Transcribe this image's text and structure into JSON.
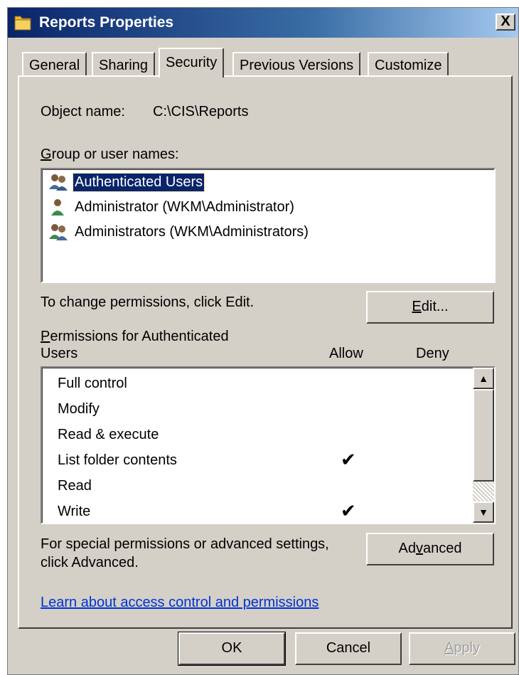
{
  "window": {
    "title": "Reports Properties",
    "close_label": "X"
  },
  "tabs": [
    {
      "label": "General",
      "active": false
    },
    {
      "label": "Sharing",
      "active": false
    },
    {
      "label": "Security",
      "active": true
    },
    {
      "label": "Previous Versions",
      "active": false
    },
    {
      "label": "Customize",
      "active": false
    }
  ],
  "security": {
    "object_name_label": "Object name:",
    "object_name_value": "C:\\CIS\\Reports",
    "group_label_u": "G",
    "group_label_rest": "roup or user names:",
    "users": [
      {
        "name": "Authenticated Users",
        "icon": "users-group-icon",
        "selected": true
      },
      {
        "name": "Administrator (WKM\\Administrator)",
        "icon": "user-icon",
        "selected": false
      },
      {
        "name": "Administrators (WKM\\Administrators)",
        "icon": "users-group-icon",
        "selected": false
      }
    ],
    "change_hint": "To change permissions, click Edit.",
    "edit_button_u": "E",
    "edit_button_rest": "dit...",
    "permissions_label_u": "P",
    "permissions_label_line1_rest": "ermissions for Authenticated",
    "permissions_label_line2": "Users",
    "allow_header": "Allow",
    "deny_header": "Deny",
    "permissions": [
      {
        "name": "Full control",
        "allow": false,
        "deny": false
      },
      {
        "name": "Modify",
        "allow": false,
        "deny": false
      },
      {
        "name": "Read & execute",
        "allow": false,
        "deny": false
      },
      {
        "name": "List folder contents",
        "allow": true,
        "deny": false
      },
      {
        "name": "Read",
        "allow": false,
        "deny": false
      },
      {
        "name": "Write",
        "allow": true,
        "deny": false
      }
    ],
    "check_glyph": "✔",
    "advanced_hint_line1": "For special permissions or advanced settings,",
    "advanced_hint_line2": "click Advanced.",
    "advanced_button_pre": "Ad",
    "advanced_button_u": "v",
    "advanced_button_post": "anced",
    "learn_link": "Learn about access control and permissions"
  },
  "footer": {
    "ok_label": "OK",
    "cancel_label": "Cancel",
    "apply_u": "A",
    "apply_rest": "pply"
  },
  "colors": {
    "selection": "#0a246a",
    "dialog_face": "#d4d0c8",
    "link": "#0033cc"
  }
}
